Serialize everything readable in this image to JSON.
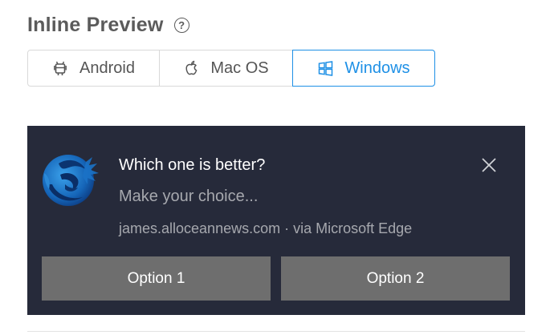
{
  "header": {
    "title": "Inline Preview",
    "help_icon": "question-circle-icon",
    "help_glyph": "?"
  },
  "tabs": [
    {
      "label": "Android",
      "icon": "android-icon",
      "selected": false
    },
    {
      "label": "Mac OS",
      "icon": "apple-icon",
      "selected": false
    },
    {
      "label": "Windows",
      "icon": "windows-icon",
      "selected": true
    }
  ],
  "notification": {
    "title": "Which one is better?",
    "body": "Make your choice...",
    "source": "james.alloceannews.com · via Microsoft Edge",
    "close_icon": "close-icon",
    "options": [
      {
        "label": "Option 1"
      },
      {
        "label": "Option 2"
      }
    ]
  },
  "colors": {
    "accent": "#1e90e6",
    "notification_bg": "#262a3a",
    "option_bg": "#6e6e6e",
    "title_text": "#5b5b5b"
  }
}
